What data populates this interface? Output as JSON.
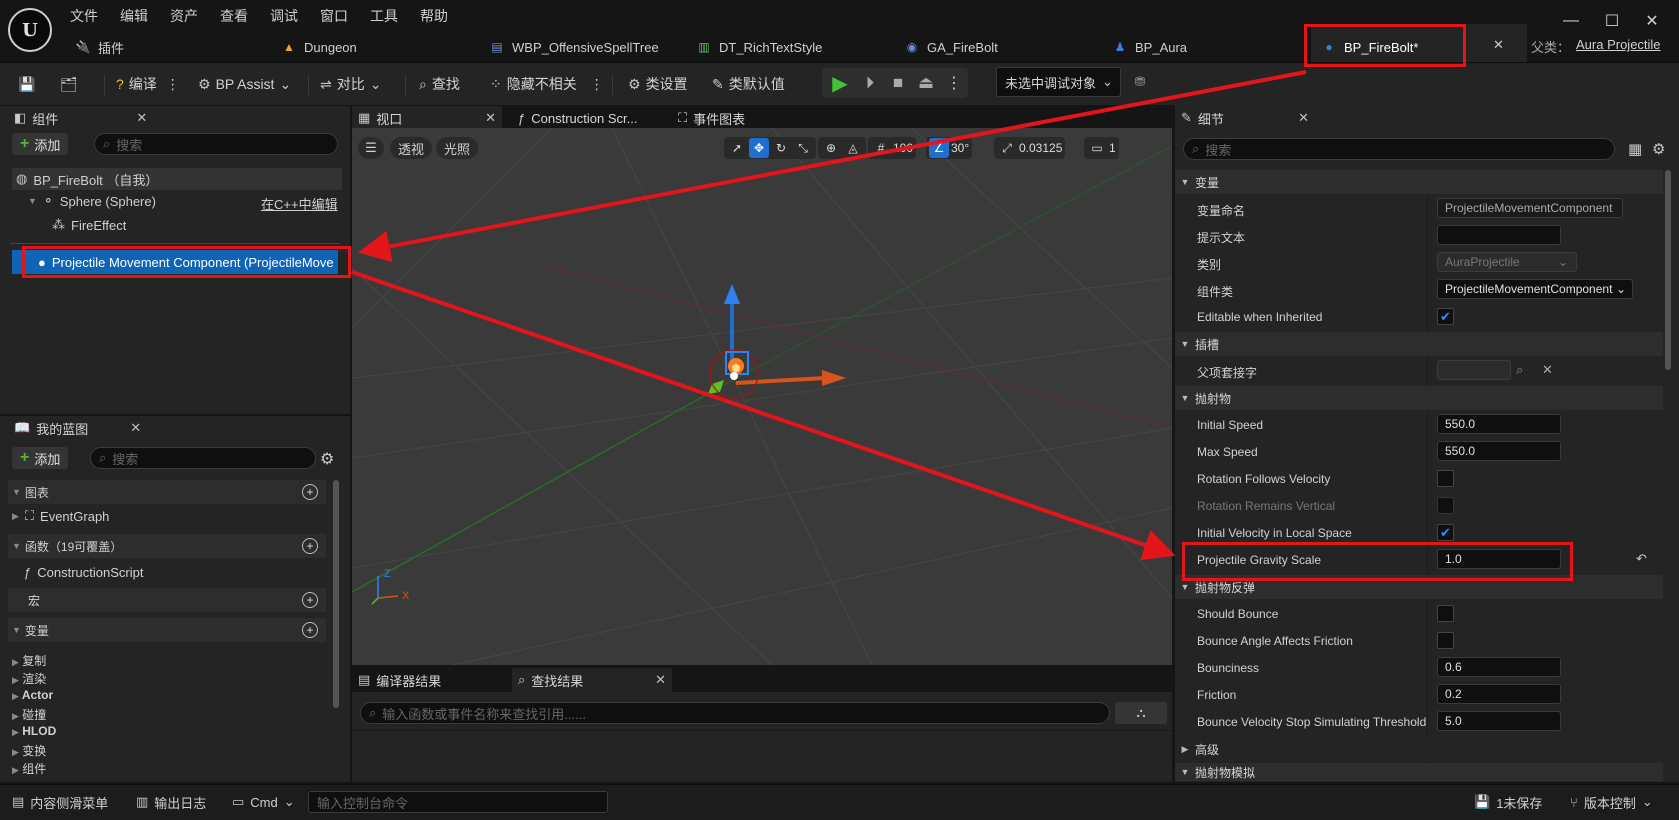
{
  "menu": [
    "文件",
    "编辑",
    "资产",
    "查看",
    "调试",
    "窗口",
    "工具",
    "帮助"
  ],
  "doc_tabs": [
    {
      "label": "插件",
      "icon": "plugin-icon"
    },
    {
      "label": "Dungeon",
      "icon": "level-icon"
    },
    {
      "label": "WBP_OffensiveSpellTree",
      "icon": "widget-blueprint-icon"
    },
    {
      "label": "DT_RichTextStyle",
      "icon": "data-table-icon"
    },
    {
      "label": "GA_FireBolt",
      "icon": "gameplay-ability-icon"
    },
    {
      "label": "BP_Aura",
      "icon": "character-blueprint-icon"
    },
    {
      "label": "BP_FireBolt*",
      "icon": "actor-blueprint-icon"
    }
  ],
  "parent_class": {
    "label": "父类：",
    "value": "Aura Projectile"
  },
  "toolbar": {
    "compile": "编译",
    "bp_assist": "BP Assist",
    "diff": "对比",
    "find": "查找",
    "hide_unrelated": "隐藏不相关",
    "class_settings": "类设置",
    "class_defaults": "类默认值",
    "debug_target": "未选中调试对象"
  },
  "components_panel": {
    "tab": "组件",
    "add": "添加",
    "search_placeholder": "搜索",
    "root": "BP_FireBolt （自我）",
    "sphere": "Sphere (Sphere)",
    "edit_cpp": "在C++中编辑",
    "fire_effect": "FireEffect",
    "projectile_movement": "Projectile Movement Component (ProjectileMove"
  },
  "my_blueprint": {
    "tab": "我的蓝图",
    "add": "添加",
    "search_placeholder": "搜索",
    "graphs": "图表",
    "event_graph": "EventGraph",
    "functions": "函数（19可覆盖）",
    "construction_script": "ConstructionScript",
    "macros": "宏",
    "variables": "变量",
    "var_groups": [
      "复制",
      "渲染",
      "Actor",
      "碰撞",
      "HLOD",
      "变换",
      "组件"
    ]
  },
  "editor_tabs": {
    "viewport": "视口",
    "construction": "Construction Scr...",
    "event_graph": "事件图表"
  },
  "viewport": {
    "perspective": "透视",
    "lighting": "光照",
    "grid_snap": "100",
    "rotation_snap": "30°",
    "scale_snap": "0.03125",
    "camera_speed": "1",
    "axis_x": "X",
    "axis_z": "Z"
  },
  "bottom_panel": {
    "compiler_results": "编译器结果",
    "find_results": "查找结果",
    "find_placeholder": "输入函数或事件名称来查找引用......"
  },
  "details": {
    "tab": "细节",
    "search_placeholder": "搜索",
    "sections": {
      "variable": "变量",
      "sockets": "插槽",
      "projectile": "抛射物",
      "bounces": "抛射物反弹",
      "advanced": "高级",
      "simulation": "抛射物模拟"
    },
    "variable_name_label": "变量命名",
    "variable_name_value": "ProjectileMovementComponent",
    "tooltip_label": "提示文本",
    "category_label": "类别",
    "category_value": "AuraProjectile",
    "component_class_label": "组件类",
    "component_class_value": "ProjectileMovementComponent",
    "editable_inherited": "Editable when Inherited",
    "parent_socket": "父项套接字",
    "initial_speed": {
      "label": "Initial Speed",
      "value": "550.0"
    },
    "max_speed": {
      "label": "Max Speed",
      "value": "550.0"
    },
    "rotation_follows_velocity": "Rotation Follows Velocity",
    "rotation_remains_vertical": "Rotation Remains Vertical",
    "initial_velocity_local": "Initial Velocity in Local Space",
    "gravity_scale": {
      "label": "Projectile Gravity Scale",
      "value": "1.0"
    },
    "should_bounce": "Should Bounce",
    "bounce_angle_friction": "Bounce Angle Affects Friction",
    "bounciness": {
      "label": "Bounciness",
      "value": "0.6"
    },
    "friction": {
      "label": "Friction",
      "value": "0.2"
    },
    "bounce_threshold": {
      "label": "Bounce Velocity Stop Simulating Threshold",
      "value": "5.0"
    }
  },
  "statusbar": {
    "content_drawer": "内容侧滑菜单",
    "output_log": "输出日志",
    "cmd": "Cmd",
    "console_placeholder": "输入控制台命令",
    "unsaved": "1未保存",
    "source_control": "版本控制"
  },
  "colors": {
    "accent_blue": "#1f6fd1",
    "annotation_red": "#e4141b",
    "add_green": "#59b33b"
  }
}
